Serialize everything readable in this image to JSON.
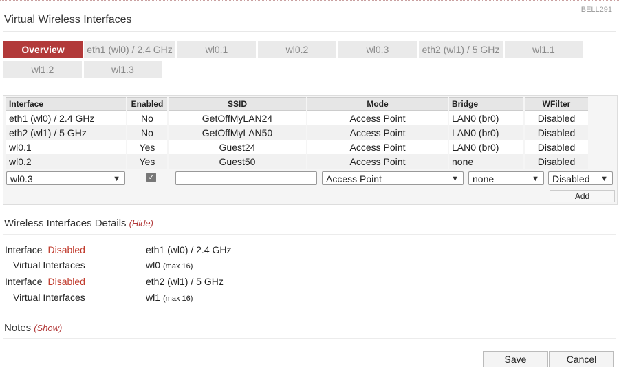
{
  "brand": "BELL291",
  "page_title": "Virtual Wireless Interfaces",
  "tabs": [
    {
      "label": "Overview",
      "active": true
    },
    {
      "label": "eth1 (wl0) / 2.4 GHz"
    },
    {
      "label": "wl0.1"
    },
    {
      "label": "wl0.2"
    },
    {
      "label": "wl0.3"
    },
    {
      "label": "eth2 (wl1) / 5 GHz"
    },
    {
      "label": "wl1.1"
    },
    {
      "label": "wl1.2"
    },
    {
      "label": "wl1.3"
    }
  ],
  "table": {
    "headers": [
      "Interface",
      "Enabled",
      "SSID",
      "Mode",
      "Bridge",
      "WFilter"
    ],
    "rows": [
      [
        "eth1 (wl0) / 2.4 GHz",
        "No",
        "GetOffMyLAN24",
        "Access Point",
        "LAN0 (br0)",
        "Disabled"
      ],
      [
        "eth2 (wl1) / 5 GHz",
        "No",
        "GetOffMyLAN50",
        "Access Point",
        "LAN0 (br0)",
        "Disabled"
      ],
      [
        "wl0.1",
        "Yes",
        "Guest24",
        "Access Point",
        "LAN0 (br0)",
        "Disabled"
      ],
      [
        "wl0.2",
        "Yes",
        "Guest50",
        "Access Point",
        "none",
        "Disabled"
      ]
    ],
    "edit": {
      "interface": "wl0.3",
      "enabled_checked": true,
      "ssid": "",
      "mode": "Access Point",
      "bridge": "none",
      "wfilter": "Disabled"
    },
    "add_label": "Add"
  },
  "details": {
    "title": "Wireless Interfaces Details",
    "toggle": "(Hide)",
    "items": [
      {
        "label": "Interface",
        "status": "Disabled",
        "value": "eth1 (wl0) / 2.4 GHz"
      },
      {
        "label": "Virtual Interfaces",
        "value": "wl0",
        "note": "(max 16)"
      },
      {
        "label": "Interface",
        "status": "Disabled",
        "value": "eth2 (wl1) / 5 GHz"
      },
      {
        "label": "Virtual Interfaces",
        "value": "wl1",
        "note": "(max 16)"
      }
    ]
  },
  "notes": {
    "title": "Notes",
    "toggle": "(Show)"
  },
  "buttons": {
    "save": "Save",
    "cancel": "Cancel"
  }
}
